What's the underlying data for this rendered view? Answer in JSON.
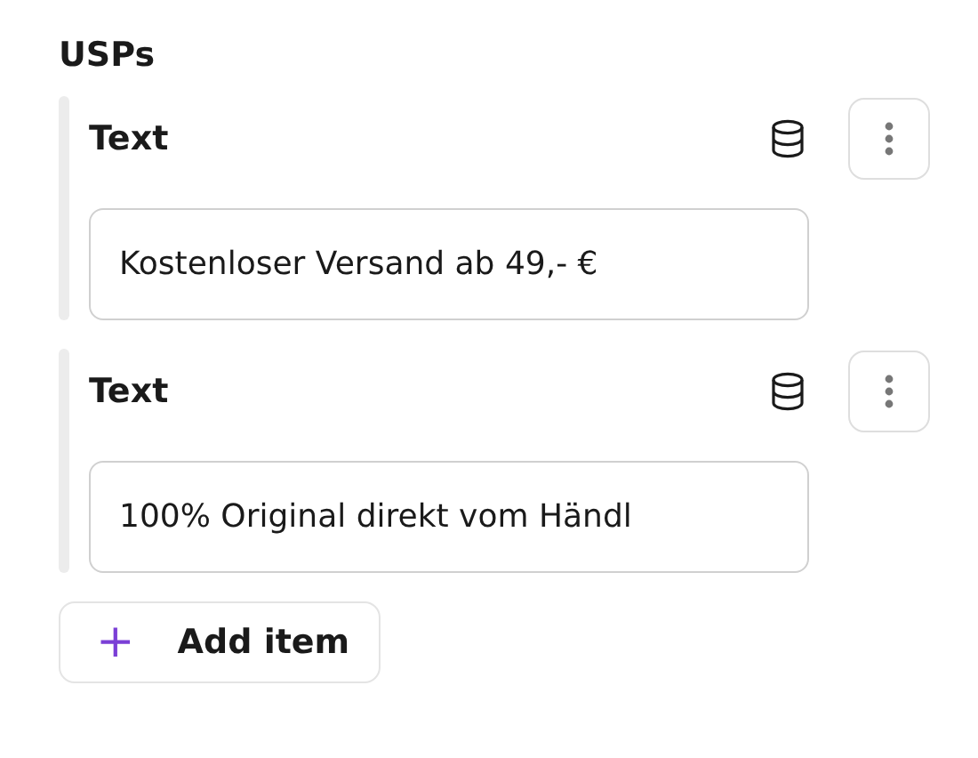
{
  "section_title": "USPs",
  "items": [
    {
      "label": "Text",
      "value": "Kostenloser Versand ab 49,- €"
    },
    {
      "label": "Text",
      "value": "100% Original direkt vom Händl"
    }
  ],
  "add_button": {
    "icon": "+",
    "label": "Add item"
  }
}
